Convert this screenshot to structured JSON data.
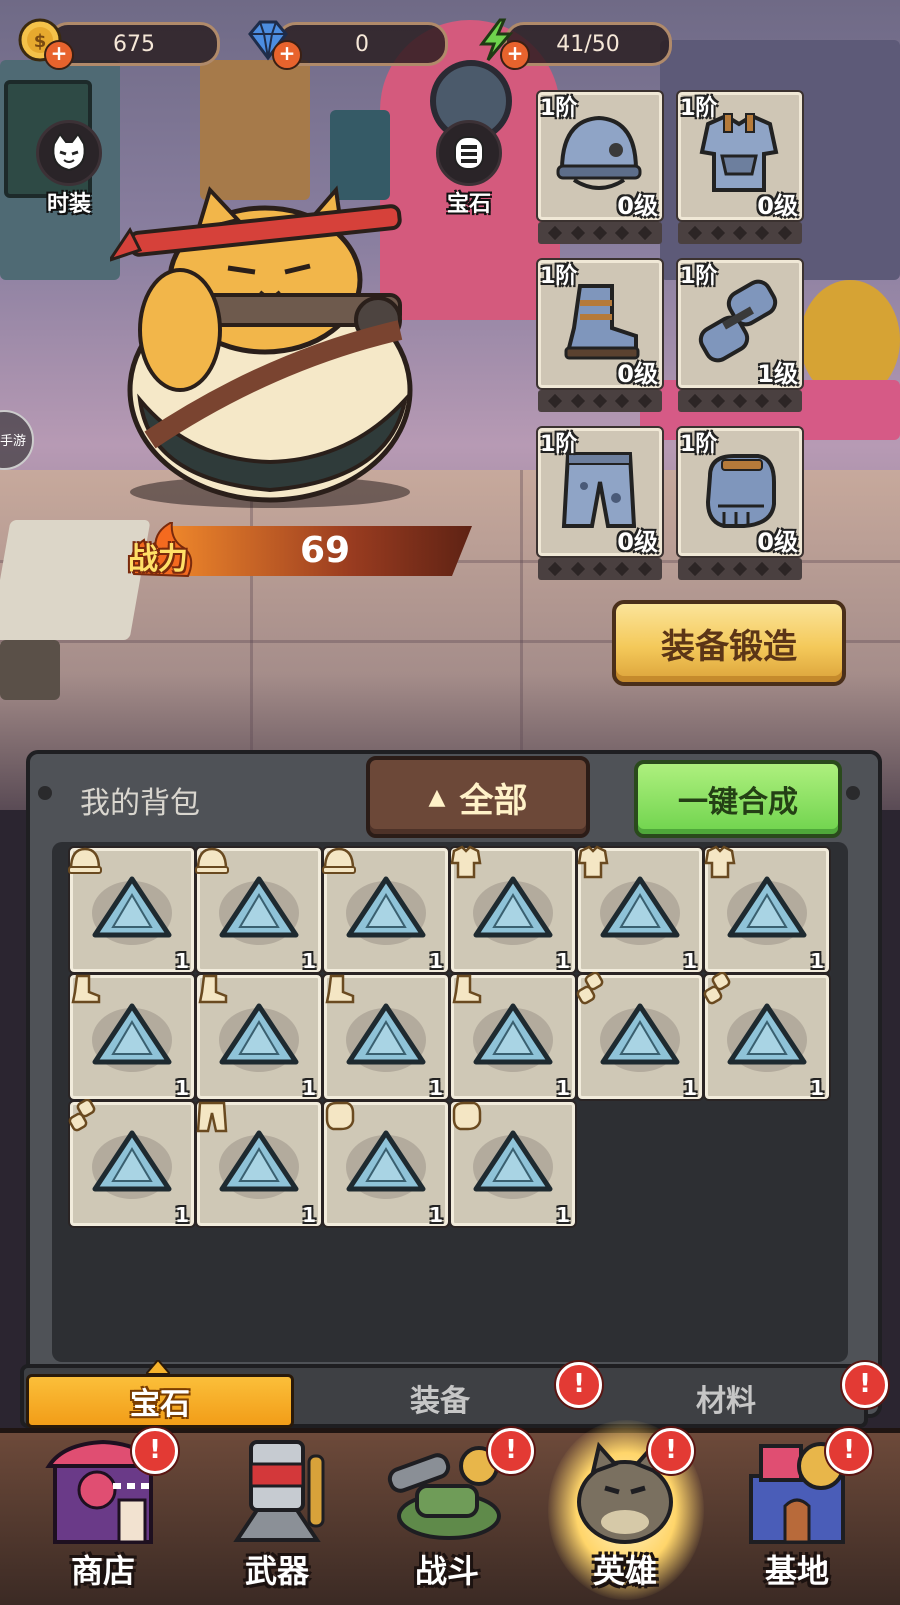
{
  "resources": {
    "gold": "675",
    "diamond": "0",
    "energy": "41/50"
  },
  "side": {
    "fashion_label": "时装",
    "gem_label": "宝石",
    "bubble_label": "手游"
  },
  "equipment": [
    {
      "slot": "helmet",
      "tier": "1阶",
      "level": "0级"
    },
    {
      "slot": "armor",
      "tier": "1阶",
      "level": "0级"
    },
    {
      "slot": "boots",
      "tier": "1阶",
      "level": "0级"
    },
    {
      "slot": "gloves",
      "tier": "1阶",
      "level": "1级"
    },
    {
      "slot": "pants",
      "tier": "1阶",
      "level": "0级"
    },
    {
      "slot": "gauntlet",
      "tier": "1阶",
      "level": "0级"
    }
  ],
  "power": {
    "label": "战力",
    "value": "69"
  },
  "forge_label": "装备锻造",
  "bag": {
    "title": "我的背包",
    "filter_label": "全部",
    "merge_label": "一键合成",
    "items": [
      {
        "type": "helmet",
        "count": "1"
      },
      {
        "type": "helmet",
        "count": "1"
      },
      {
        "type": "helmet",
        "count": "1"
      },
      {
        "type": "armor",
        "count": "1"
      },
      {
        "type": "armor",
        "count": "1"
      },
      {
        "type": "armor",
        "count": "1"
      },
      {
        "type": "boots",
        "count": "1"
      },
      {
        "type": "boots",
        "count": "1"
      },
      {
        "type": "boots",
        "count": "1"
      },
      {
        "type": "boots",
        "count": "1"
      },
      {
        "type": "gloves",
        "count": "1"
      },
      {
        "type": "gloves",
        "count": "1"
      },
      {
        "type": "gloves",
        "count": "1"
      },
      {
        "type": "pants",
        "count": "1"
      },
      {
        "type": "gauntlet",
        "count": "1"
      },
      {
        "type": "gauntlet",
        "count": "1"
      }
    ]
  },
  "tabs": [
    {
      "label": "宝石",
      "active": true
    },
    {
      "label": "装备",
      "alert": true
    },
    {
      "label": "材料",
      "alert": true
    }
  ],
  "nav": [
    {
      "label": "商店",
      "alert": true
    },
    {
      "label": "武器",
      "alert": false
    },
    {
      "label": "战斗",
      "alert": true
    },
    {
      "label": "英雄",
      "alert": true,
      "active": true
    },
    {
      "label": "基地",
      "alert": true
    }
  ],
  "colors": {
    "accent_orange": "#f29d18",
    "merge_green": "#6fd34d",
    "forge_gold": "#f4c95a",
    "alert_red": "#e33a34"
  }
}
